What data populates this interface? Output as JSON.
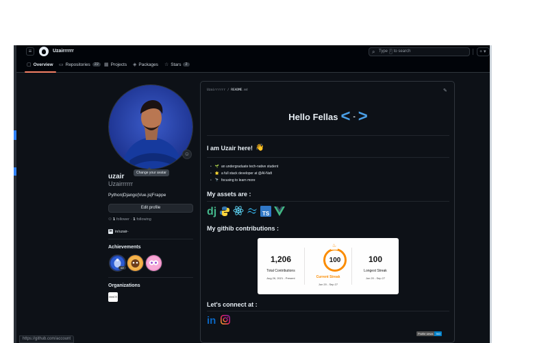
{
  "header": {
    "username": "Uzairrrrrr",
    "search_prefix": "Type",
    "search_key": "/",
    "search_suffix": "to search",
    "plus_label": "+ ▾"
  },
  "tabs": [
    {
      "label": "Overview",
      "icon": "book-icon",
      "count": ""
    },
    {
      "label": "Repositories",
      "icon": "repo-icon",
      "count": "22"
    },
    {
      "label": "Projects",
      "icon": "table-icon",
      "count": ""
    },
    {
      "label": "Packages",
      "icon": "package-icon",
      "count": ""
    },
    {
      "label": "Stars",
      "icon": "star-icon",
      "count": "2"
    }
  ],
  "profile": {
    "tooltip": "Change your avatar",
    "name": "uzair",
    "login": "Uzairrrrrr",
    "bio": "Python|Django|Vue.js|Frappe",
    "edit_label": "Edit profile",
    "followers": "1",
    "followers_label": "follower ·",
    "following": "1",
    "following_label": "following",
    "linkedin": "in/uzair-",
    "achievements_title": "Achievements",
    "badge_multiplier": "x2",
    "organizations_title": "Organizations",
    "org_label": "IdealOS"
  },
  "readme": {
    "path_user": "Uzairrrrrr",
    "path_sep": "/",
    "path_file": "README",
    "path_ext": ".md",
    "greeting": "Hello Fellas",
    "code_left": "<",
    "code_mid": "-",
    "code_right": ">",
    "intro": "I am Uzair here!",
    "bullets": [
      {
        "emoji": "🌱",
        "text": "an undergraduate tech-native student"
      },
      {
        "emoji": "🌟",
        "text": "a full stack developer at @Al-Nafi"
      },
      {
        "emoji": "🔭",
        "text": "focusing to learn more"
      }
    ],
    "assets_title": "My assets are :",
    "contrib_title": "My githib contributions :",
    "connect_title": "Let's connect at :",
    "views_label": "Profile views",
    "views_count": "563"
  },
  "stats": {
    "total": "1,206",
    "total_label": "Total Contributions",
    "total_range": "Aug 26, 2021 - Present",
    "current": "100",
    "current_label": "Current Streak",
    "current_range": "Jun 20 - Sep 27",
    "longest": "100",
    "longest_label": "Longest Streak",
    "longest_range": "Jun 20 - Sep 27"
  },
  "status_url": "https://github.com/account",
  "colors": {
    "bg": "#0d1117",
    "accent_tab": "#f78166",
    "streak": "#fb8c00",
    "vue": "#41b883",
    "django": "#44b78b",
    "tailwind": "#38bdf8",
    "typescript": "#3178c6",
    "linkedin": "#0a66c2"
  }
}
